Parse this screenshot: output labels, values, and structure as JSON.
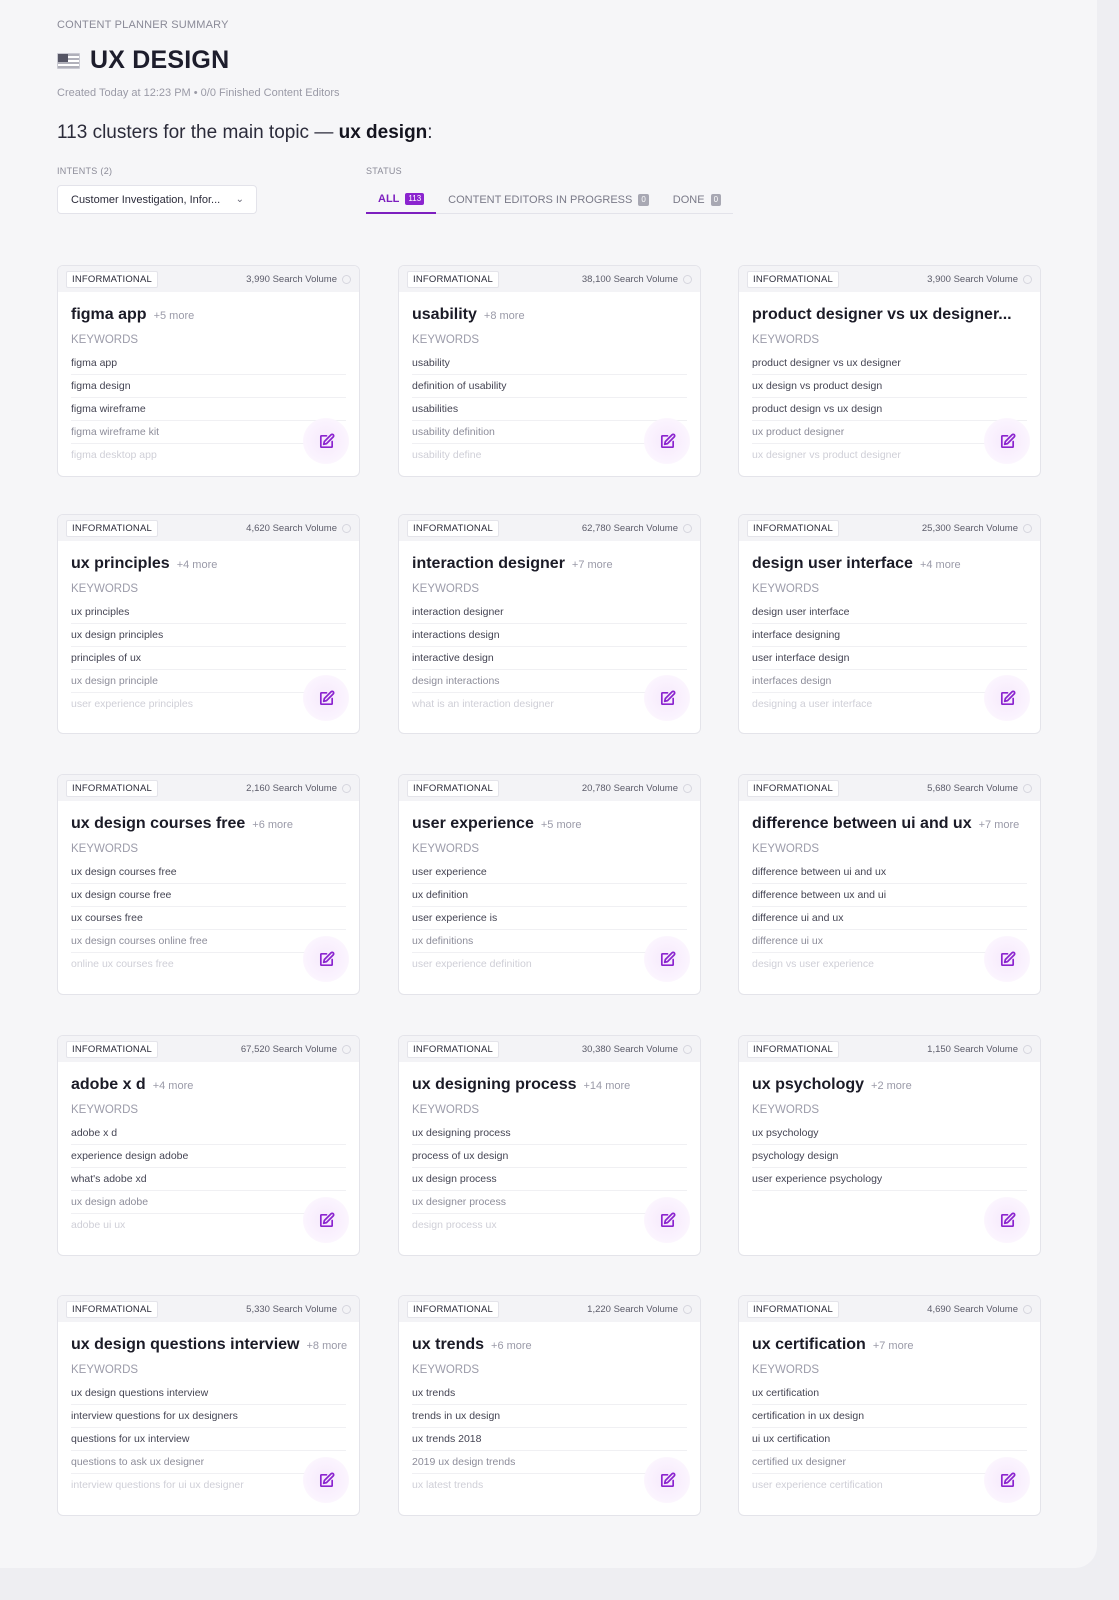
{
  "header": {
    "eyebrow": "CONTENT PLANNER SUMMARY",
    "title": "UX DESIGN",
    "meta": "Created Today at 12:23 PM • 0/0 Finished Content Editors",
    "headline_prefix": "113 clusters for the main topic — ",
    "headline_topic": "ux design",
    "headline_suffix": ":"
  },
  "filters": {
    "intents_label": "INTENTS (2)",
    "intents_value": "Customer Investigation, Infor...",
    "status_label": "STATUS",
    "tabs": [
      {
        "label": "ALL",
        "count": "113"
      },
      {
        "label": "CONTENT EDITORS IN PROGRESS",
        "count": "0"
      },
      {
        "label": "DONE",
        "count": "0"
      }
    ]
  },
  "icons": {
    "flag": "us-flag-icon",
    "dropdown": "chevron-down-icon",
    "edit": "edit-icon"
  },
  "colors": {
    "accent": "#7d1fbf"
  },
  "keywords_label": "KEYWORDS",
  "cards": [
    {
      "intent": "INFORMATIONAL",
      "volume": "3,990 Search Volume",
      "title": "figma app",
      "more": "+5 more",
      "keywords": [
        "figma app",
        "figma design",
        "figma wireframe",
        "figma wireframe kit",
        "figma desktop app"
      ]
    },
    {
      "intent": "INFORMATIONAL",
      "volume": "38,100 Search Volume",
      "title": "usability",
      "more": "+8 more",
      "keywords": [
        "usability",
        "definition of usability",
        "usabilities",
        "usability definition",
        "usability define"
      ]
    },
    {
      "intent": "INFORMATIONAL",
      "volume": "3,900 Search Volume",
      "title": "product designer vs ux designer...",
      "more": "",
      "keywords": [
        "product designer vs ux designer",
        "ux design vs product design",
        "product design vs ux design",
        "ux product designer",
        "ux designer vs product designer"
      ]
    },
    {
      "intent": "INFORMATIONAL",
      "volume": "4,620 Search Volume",
      "title": "ux principles",
      "more": "+4 more",
      "keywords": [
        "ux principles",
        "ux design principles",
        "principles of ux",
        "ux design principle",
        "user experience principles"
      ]
    },
    {
      "intent": "INFORMATIONAL",
      "volume": "62,780 Search Volume",
      "title": "interaction designer",
      "more": "+7 more",
      "keywords": [
        "interaction designer",
        "interactions design",
        "interactive design",
        "design interactions",
        "what is an interaction designer"
      ]
    },
    {
      "intent": "INFORMATIONAL",
      "volume": "25,300 Search Volume",
      "title": "design user interface",
      "more": "+4 more",
      "keywords": [
        "design user interface",
        "interface designing",
        "user interface design",
        "interfaces design",
        "designing a user interface"
      ]
    },
    {
      "intent": "INFORMATIONAL",
      "volume": "2,160 Search Volume",
      "title": "ux design courses free",
      "more": "+6 more",
      "keywords": [
        "ux design courses free",
        "ux design course free",
        "ux courses free",
        "ux design courses online free",
        "online ux courses free"
      ]
    },
    {
      "intent": "INFORMATIONAL",
      "volume": "20,780 Search Volume",
      "title": "user experience",
      "more": "+5 more",
      "keywords": [
        "user experience",
        "ux definition",
        "user experience is",
        "ux definitions",
        "user experience definition"
      ]
    },
    {
      "intent": "INFORMATIONAL",
      "volume": "5,680 Search Volume",
      "title": "difference between ui and ux",
      "more": "+7 more",
      "keywords": [
        "difference between ui and ux",
        "difference between ux and ui",
        "difference ui and ux",
        "difference ui ux",
        "design vs user experience"
      ]
    },
    {
      "intent": "INFORMATIONAL",
      "volume": "67,520 Search Volume",
      "title": "adobe x d",
      "more": "+4 more",
      "keywords": [
        "adobe x d",
        "experience design adobe",
        "what's adobe xd",
        "ux design adobe",
        "adobe ui ux"
      ]
    },
    {
      "intent": "INFORMATIONAL",
      "volume": "30,380 Search Volume",
      "title": "ux designing process",
      "more": "+14 more",
      "keywords": [
        "ux designing process",
        "process of ux design",
        "ux design process",
        "ux designer process",
        "design process ux"
      ]
    },
    {
      "intent": "INFORMATIONAL",
      "volume": "1,150 Search Volume",
      "title": "ux psychology",
      "more": "+2 more",
      "keywords": [
        "ux psychology",
        "psychology design",
        "user experience psychology"
      ]
    },
    {
      "intent": "INFORMATIONAL",
      "volume": "5,330 Search Volume",
      "title": "ux design questions interview",
      "more": "+8 more",
      "keywords": [
        "ux design questions interview",
        "interview questions for ux designers",
        "questions for ux interview",
        "questions to ask ux designer",
        "interview questions for ui ux designer"
      ]
    },
    {
      "intent": "INFORMATIONAL",
      "volume": "1,220 Search Volume",
      "title": "ux trends",
      "more": "+6 more",
      "keywords": [
        "ux trends",
        "trends in ux design",
        "ux trends 2018",
        "2019 ux design trends",
        "ux latest trends"
      ]
    },
    {
      "intent": "INFORMATIONAL",
      "volume": "4,690 Search Volume",
      "title": "ux certification",
      "more": "+7 more",
      "keywords": [
        "ux certification",
        "certification in ux design",
        "ui ux certification",
        "certified ux designer",
        "user experience certification"
      ]
    }
  ]
}
